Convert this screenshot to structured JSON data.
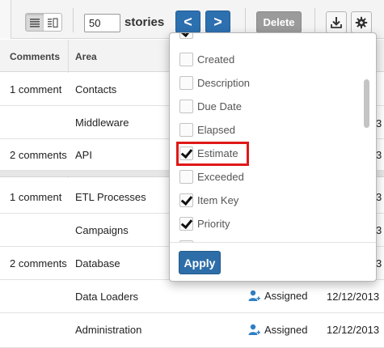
{
  "toolbar": {
    "count_value": "50",
    "stories_label": "stories",
    "prev_label": "<",
    "next_label": ">",
    "delete_label": "Delete"
  },
  "table": {
    "headers": {
      "comments": "Comments",
      "area": "Area"
    },
    "rows": [
      {
        "comments": "1 comment",
        "area": "Contacts",
        "status": "",
        "date": ""
      },
      {
        "comments": "",
        "area": "Middleware",
        "status": "",
        "date": "3"
      },
      {
        "comments": "2 comments",
        "area": "API",
        "status": "",
        "date": "3"
      },
      {
        "comments": "1 comment",
        "area": "ETL Processes",
        "status": "",
        "date": "3"
      },
      {
        "comments": "",
        "area": "Campaigns",
        "status": "",
        "date": "3"
      },
      {
        "comments": "2 comments",
        "area": "Database",
        "status": "",
        "date": "3"
      },
      {
        "comments": "",
        "area": "Data Loaders",
        "status": "Assigned",
        "date": "12/12/2013"
      },
      {
        "comments": "",
        "area": "Administration",
        "status": "Assigned",
        "date": "12/12/2013"
      }
    ]
  },
  "columns_menu": {
    "items": [
      {
        "label": "",
        "checked": true
      },
      {
        "label": "Created",
        "checked": false
      },
      {
        "label": "Description",
        "checked": false
      },
      {
        "label": "Due Date",
        "checked": false
      },
      {
        "label": "Elapsed",
        "checked": false
      },
      {
        "label": "Estimate",
        "checked": true
      },
      {
        "label": "Exceeded",
        "checked": false
      },
      {
        "label": "Item Key",
        "checked": true
      },
      {
        "label": "Priority",
        "checked": true
      },
      {
        "label": "",
        "checked": false
      }
    ],
    "apply_label": "Apply"
  }
}
